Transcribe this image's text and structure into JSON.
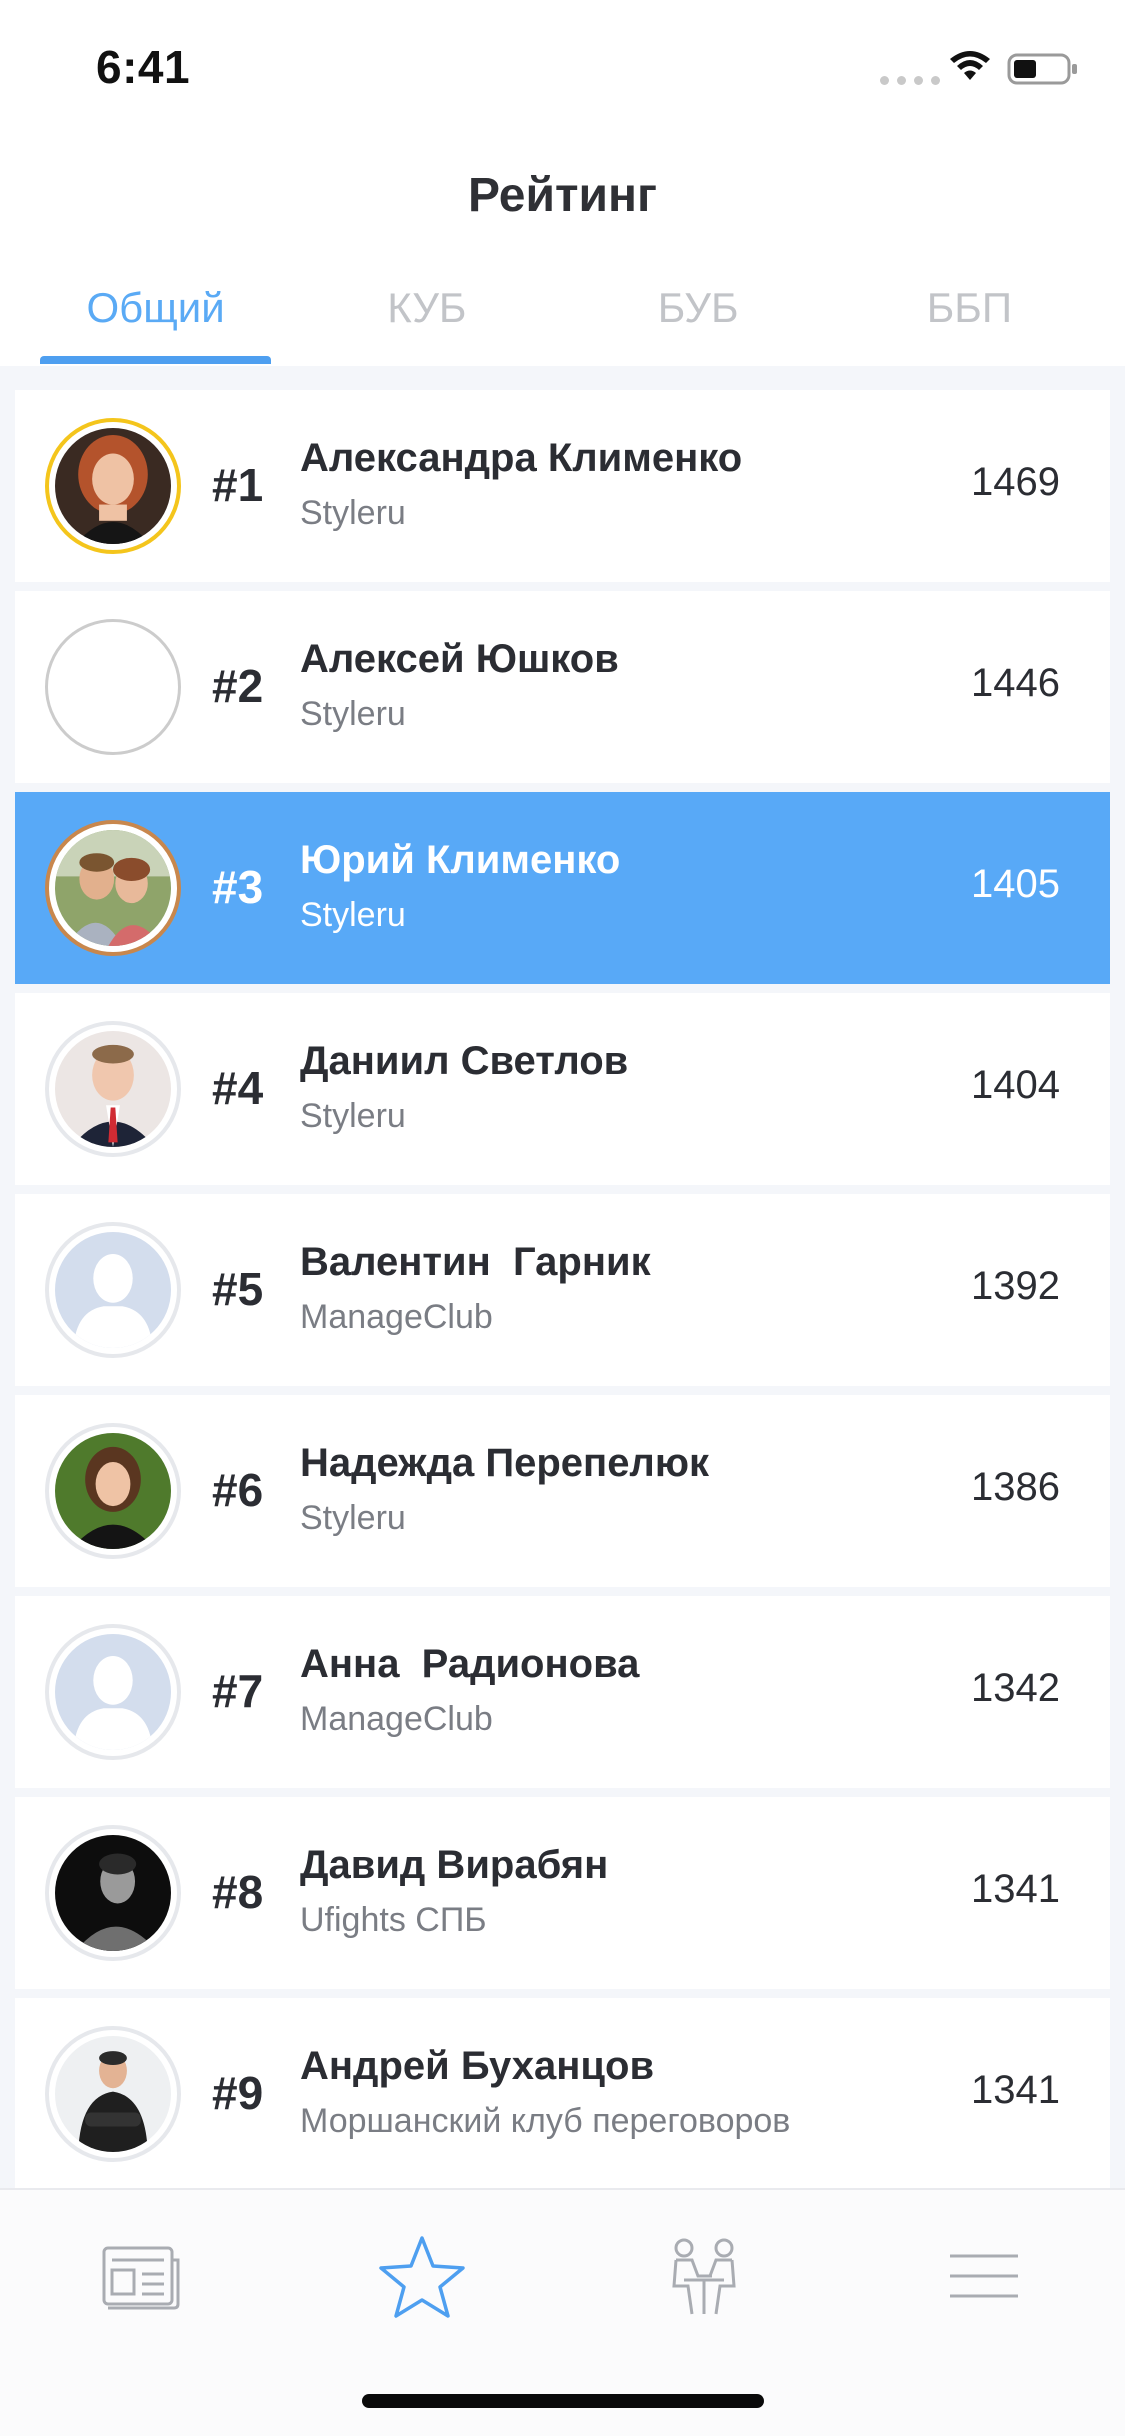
{
  "status_bar": {
    "time": "6:41"
  },
  "header": {
    "title": "Рейтинг"
  },
  "tabs": [
    {
      "label": "Общий",
      "active": true
    },
    {
      "label": "КУБ",
      "active": false
    },
    {
      "label": "БУБ",
      "active": false
    },
    {
      "label": "ББП",
      "active": false
    }
  ],
  "rating": [
    {
      "rank": "#1",
      "name": "Александра Клименко",
      "club": "Styleru",
      "score": "1469",
      "avatar": "photo-woman-red-hair"
    },
    {
      "rank": "#2",
      "name": "Алексей Юшков",
      "club": "Styleru",
      "score": "1446",
      "avatar": "empty"
    },
    {
      "rank": "#3",
      "name": "Юрий Клименко",
      "club": "Styleru",
      "score": "1405",
      "avatar": "photo-couple",
      "highlighted": true
    },
    {
      "rank": "#4",
      "name": "Даниил Светлов",
      "club": "Styleru",
      "score": "1404",
      "avatar": "photo-man-suit"
    },
    {
      "rank": "#5",
      "name": "Валентин  Гарник",
      "club": "ManageClub",
      "score": "1392",
      "avatar": "placeholder-user-icon"
    },
    {
      "rank": "#6",
      "name": "Надежда Перепелюк",
      "club": "Styleru",
      "score": "1386",
      "avatar": "photo-woman-dark"
    },
    {
      "rank": "#7",
      "name": "Анна  Радионова",
      "club": "ManageClub",
      "score": "1342",
      "avatar": "placeholder-user-icon"
    },
    {
      "rank": "#8",
      "name": "Давид Вирабян",
      "club": "Ufights СПБ",
      "score": "1341",
      "avatar": "photo-man-bw"
    },
    {
      "rank": "#9",
      "name": "Андрей Буханцов",
      "club": "Моршанский клуб переговоров",
      "score": "1341",
      "avatar": "photo-man-arms-crossed"
    }
  ],
  "bottom_nav": [
    {
      "icon": "news-icon",
      "active": false
    },
    {
      "icon": "star-icon",
      "active": true
    },
    {
      "icon": "negotiation-icon",
      "active": false
    },
    {
      "icon": "menu-icon",
      "active": false
    }
  ],
  "colors": {
    "accent": "#58a9f7",
    "gold_ring": "#f4c51c",
    "bronze_ring": "#c8874d",
    "inactive_tab": "#c2c4c8"
  }
}
